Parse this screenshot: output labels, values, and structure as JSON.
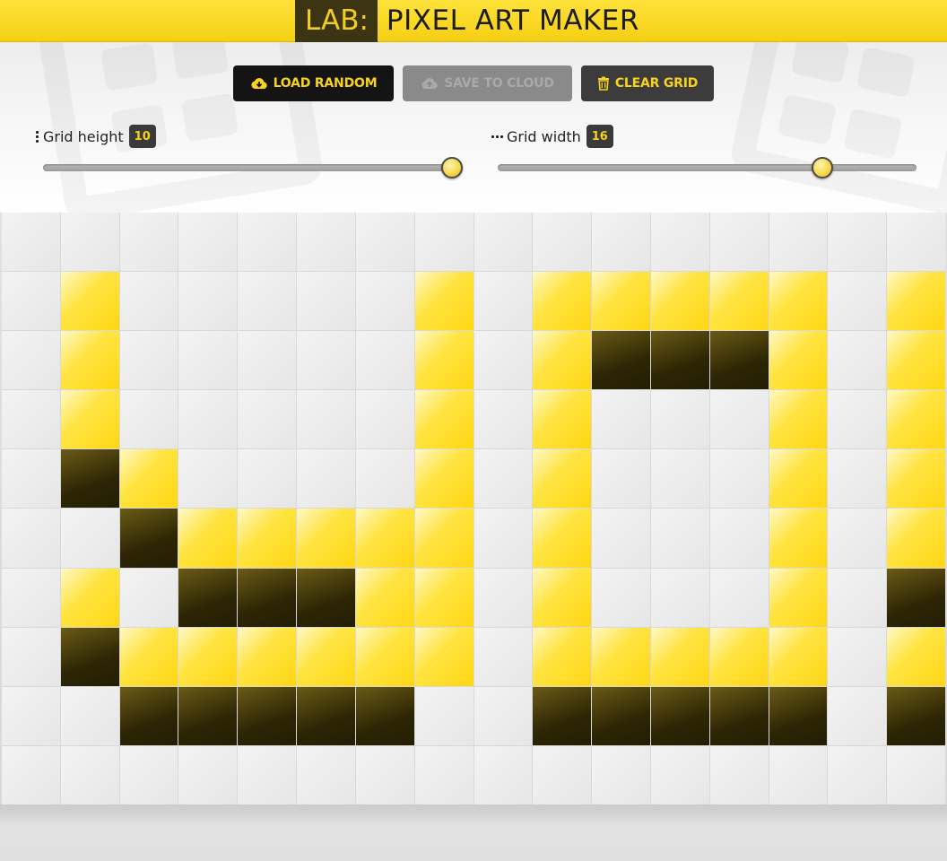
{
  "header": {
    "prefix": "LAB:",
    "title": "PIXEL ART MAKER"
  },
  "toolbar": {
    "load_label": "LOAD RANDOM",
    "save_label": "SAVE TO CLOUD",
    "clear_label": "CLEAR GRID"
  },
  "controls": {
    "height": {
      "label": "Grid height",
      "value": "10",
      "min": 1,
      "max": 10,
      "icon": "vertical-dots-icon"
    },
    "width": {
      "label": "Grid width",
      "value": "16",
      "min": 1,
      "max": 20,
      "icon": "horizontal-dots-icon"
    }
  },
  "colors": {
    "accent": "#f8d21c",
    "header_bg": "#fad928",
    "cell_empty": "#ececec",
    "cell_yellow": "#ffde2a",
    "cell_dark": "#2d2605"
  },
  "grid": {
    "rows": 10,
    "cols": 16,
    "cells": [
      "................",
      ".y.....y.yyyyy.y",
      ".y.....y.yddd y.y",
      ".y.....y.y...y.y",
      ".dy....y.y...y.y",
      "..dyyyyy.y...y.y",
      ".y.dddyy.y...y.d",
      ".dyyyyyy.yyyyy.y",
      "..ddddd..ddddd.d",
      "................"
    ]
  }
}
